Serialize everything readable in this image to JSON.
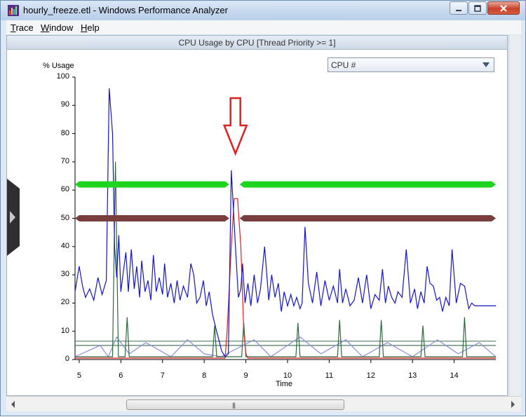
{
  "window": {
    "title": "hourly_freeze.etl - Windows Performance Analyzer"
  },
  "menu": [
    {
      "accel": "T",
      "rest": "race"
    },
    {
      "accel": "W",
      "rest": "indow"
    },
    {
      "accel": "H",
      "rest": "elp"
    }
  ],
  "panel": {
    "header": "CPU Usage by CPU [Thread Priority >= 1]",
    "dropdown_value": "CPU #"
  },
  "chart_data": {
    "type": "line",
    "ylabel": "% Usage",
    "xlabel": "Time",
    "ylim": [
      0,
      100
    ],
    "xlim": [
      4.9,
      15.0
    ],
    "yticks": [
      "100",
      "90",
      "80",
      "70",
      "60",
      "50",
      "40",
      "30",
      "20",
      "10",
      "0"
    ],
    "xticks": [
      "5",
      "6",
      "7",
      "8",
      "9",
      "10",
      "11",
      "12",
      "13",
      "14"
    ],
    "series": [
      {
        "color": "#1414c8",
        "x": [
          4.9,
          5.0,
          5.08,
          5.15,
          5.25,
          5.35,
          5.45,
          5.55,
          5.65,
          5.72,
          5.8,
          5.85,
          5.9,
          5.95,
          6.0,
          6.05,
          6.12,
          6.18,
          6.25,
          6.32,
          6.38,
          6.45,
          6.5,
          6.58,
          6.65,
          6.72,
          6.78,
          6.85,
          6.92,
          7.0,
          7.05,
          7.12,
          7.2,
          7.28,
          7.35,
          7.42,
          7.5,
          7.6,
          7.68,
          7.75,
          7.82,
          7.9,
          7.98,
          8.05,
          8.12,
          8.2,
          8.28,
          8.35,
          8.42,
          8.5,
          8.58,
          8.65,
          8.75,
          8.82,
          8.88,
          8.92,
          8.98,
          9.05,
          9.12,
          9.2,
          9.28,
          9.35,
          9.45,
          9.55,
          9.62,
          9.7,
          9.78,
          9.85,
          9.92,
          10.0,
          10.08,
          10.15,
          10.22,
          10.3,
          10.35,
          10.42,
          10.5,
          10.6,
          10.7,
          10.8,
          10.9,
          11.0,
          11.1,
          11.2,
          11.25,
          11.32,
          11.4,
          11.5,
          11.6,
          11.7,
          11.8,
          11.9,
          12.0,
          12.1,
          12.2,
          12.28,
          12.35,
          12.42,
          12.5,
          12.58,
          12.65,
          12.75,
          12.85,
          12.95,
          13.05,
          13.12,
          13.2,
          13.28,
          13.35,
          13.42,
          13.5,
          13.58,
          13.65,
          13.72,
          13.8,
          13.88,
          13.95,
          14.05,
          14.15,
          14.25,
          14.35,
          14.42,
          14.5,
          14.58,
          14.68,
          14.78,
          14.85,
          14.9,
          15.0
        ],
        "y": [
          24,
          33,
          26,
          22,
          25,
          21,
          29,
          23,
          28,
          96,
          80,
          40,
          29,
          44,
          24,
          30,
          38,
          24,
          39,
          25,
          33,
          22,
          35,
          24,
          28,
          21,
          37,
          24,
          29,
          23,
          34,
          22,
          27,
          20,
          28,
          21,
          26,
          22,
          34,
          30,
          20,
          22,
          28,
          19,
          24,
          16,
          11,
          7,
          3,
          1,
          2,
          67,
          40,
          22,
          25,
          34,
          20,
          27,
          19,
          30,
          20,
          25,
          40,
          21,
          30,
          22,
          27,
          17,
          24,
          19,
          23,
          19,
          22,
          18,
          20,
          47,
          27,
          20,
          31,
          19,
          28,
          21,
          26,
          20,
          32,
          20,
          25,
          19,
          21,
          29,
          20,
          30,
          18,
          23,
          21,
          32,
          20,
          26,
          22,
          20,
          24,
          22,
          39,
          20,
          25,
          18,
          24,
          20,
          33,
          27,
          26,
          21,
          22,
          17,
          22,
          19,
          39,
          20,
          27,
          26,
          18,
          20,
          19,
          19,
          19,
          19,
          19,
          19,
          19
        ]
      },
      {
        "color": "#e02020",
        "x": [
          4.9,
          8.5,
          8.55,
          8.65,
          8.72,
          8.8,
          8.88,
          8.95,
          9.0,
          9.05,
          15.0
        ],
        "y": [
          0.5,
          0.5,
          10,
          40,
          57,
          57,
          40,
          10,
          2,
          0.5,
          0.5
        ]
      },
      {
        "color": "#2e6a3e",
        "x": [
          4.9,
          5.8,
          5.87,
          5.94,
          6.1,
          6.15,
          6.2,
          8.2,
          8.25,
          8.3,
          8.9,
          8.95,
          9.0,
          10.2,
          10.25,
          10.3,
          11.2,
          11.25,
          11.3,
          12.2,
          12.25,
          12.3,
          13.2,
          13.25,
          13.3,
          14.2,
          14.25,
          14.3,
          15.0
        ],
        "y": [
          1,
          1,
          70,
          1,
          1,
          15,
          1,
          1,
          12,
          1,
          1,
          13,
          1,
          1,
          13,
          1,
          1,
          14,
          1,
          1,
          14,
          1,
          1,
          12,
          1,
          1,
          15,
          1,
          1
        ]
      },
      {
        "color": "#8a8ee0",
        "x": [
          4.9,
          5.5,
          5.7,
          5.9,
          6.2,
          6.6,
          7.2,
          7.6,
          8.0,
          8.4,
          9.2,
          9.6,
          10.3,
          10.8,
          11.4,
          11.8,
          12.4,
          13.0,
          13.6,
          14.1,
          14.6,
          15.0
        ],
        "y": [
          1,
          5,
          1,
          8,
          2,
          6,
          1,
          7,
          2,
          1,
          7,
          1,
          8,
          2,
          7,
          1,
          6,
          1,
          7,
          2,
          6,
          1
        ]
      },
      {
        "color": "#4f7f60",
        "x": [
          4.9,
          15.0
        ],
        "y": [
          6.5,
          6.5
        ]
      },
      {
        "color": "#557a65",
        "x": [
          4.9,
          15.0
        ],
        "y": [
          5,
          5
        ]
      }
    ],
    "annotations": [
      {
        "type": "band",
        "color": "#1fd41f",
        "y": 62,
        "x_ranges": [
          [
            4.9,
            8.6
          ],
          [
            8.85,
            15.0
          ]
        ]
      },
      {
        "type": "band",
        "color": "#7a3d3d",
        "y": 50,
        "x_ranges": [
          [
            4.9,
            8.6
          ],
          [
            8.85,
            15.0
          ]
        ]
      },
      {
        "type": "arrow",
        "color": "#e02020",
        "x": 8.75
      }
    ]
  }
}
